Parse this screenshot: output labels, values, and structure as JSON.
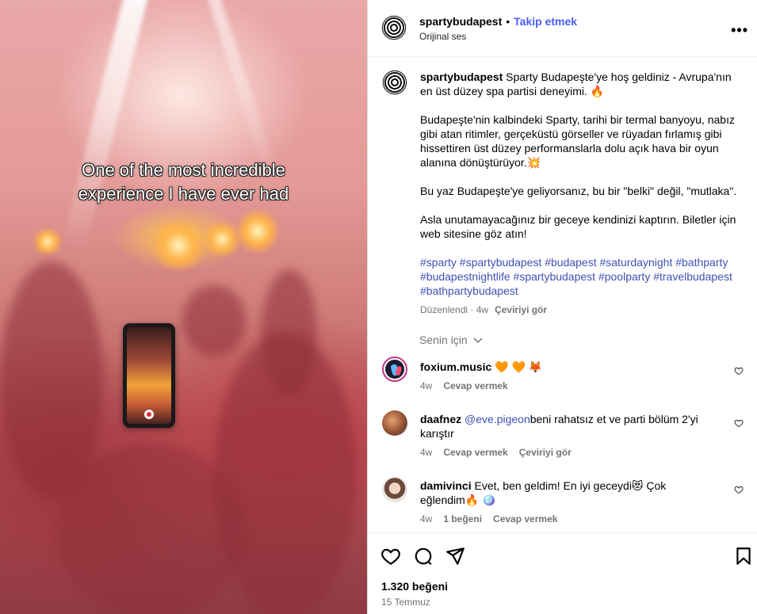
{
  "video": {
    "overlay_line1": "One of the most incredible",
    "overlay_line2": "experience I have ever had"
  },
  "header": {
    "username": "spartybudapest",
    "separator": "•",
    "follow_label": "Takip etmek",
    "audio_label": "Orijinal ses",
    "more_icon": "more-options-icon"
  },
  "caption": {
    "username": "spartybudapest",
    "line1": "Sparty Budapeşte'ye hoş geldiniz - Avrupa'nın en üst düzey spa partisi deneyimi. 🔥",
    "paragraph2": "Budapeşte'nin kalbindeki Sparty, tarihi bir termal banyoyu, nabız gibi atan ritimler, gerçeküstü görseller ve rüyadan fırlamış gibi hissettiren üst düzey performanslarla dolu açık hava bir oyun alanına dönüştürüyor.💥",
    "paragraph3": "Bu yaz Budapeşte'ye geliyorsanız, bu bir \"belki\" değil, \"mutlaka\".",
    "paragraph4": "Asla unutamayacağınız bir geceye kendinizi kaptırın. Biletler için web sitesine göz atın!",
    "hashtags": "#sparty #spartybudapest #budapest #saturdaynight #bathparty #budapestnightlife #spartybudapest #poolparty #travelbudapest #bathpartybudapest",
    "edited_label": "Düzenlendi",
    "time": "· 4w",
    "translate_label": "Çeviriyi gör"
  },
  "for_you_label": "Senin için",
  "comments": [
    {
      "username": "foxium.music",
      "text": "🧡 🧡 🦊",
      "time": "4w",
      "reply_label": "Cevap vermek",
      "avatar_color": "#1b1b2f"
    },
    {
      "username": "daafnez",
      "mention": "@eve.pigeon",
      "text": "beni rahatsız et ve parti bölüm 2'yi karıştır",
      "time": "4w",
      "reply_label": "Cevap vermek",
      "translate_label": "Çeviriyi gör",
      "avatar_color": "#c4704a"
    },
    {
      "username": "damivinci",
      "text": "Evet, ben geldim! En iyi geceydi😻 Çok eğlendim🔥 🪩",
      "time": "4w",
      "likes_label": "1 beğeni",
      "reply_label": "Cevap vermek",
      "avatar_color": "#d9bfb0"
    }
  ],
  "footer": {
    "likes": "1.320 beğeni",
    "date": "15 Temmuz"
  }
}
